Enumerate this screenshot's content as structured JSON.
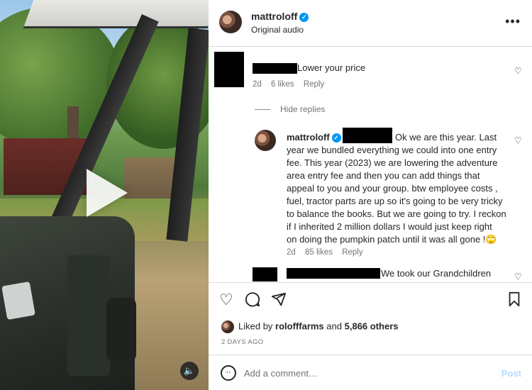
{
  "post": {
    "username": "mattroloff",
    "audio": "Original audio",
    "more_icon": "more-horizontal-icon"
  },
  "comments": {
    "first": {
      "text": "Lower your price",
      "time": "2d",
      "likes": "6 likes",
      "reply": "Reply"
    },
    "hide_replies": "Hide replies",
    "reply": {
      "username": "mattroloff",
      "lines": [
        "Ok we are this year. Last",
        "year we bundled everything we could into one entry",
        "fee. This year (2023) we are lowering the adventure",
        "area entry fee and then you can add things that",
        "appeal to you and your group. btw employee costs ,",
        "fuel, tractor parts are up so it's going to be very tricky",
        "to balance the books. But we are going to try. I reckon",
        "if I inherited 2 million dollars I would just keep right",
        "on doing the pumpkin patch until it was all gone !🙄"
      ],
      "time": "2d",
      "likes": "85 likes",
      "reply": "Reply"
    },
    "third": {
      "text": "We took our Grandchildren"
    }
  },
  "likes": {
    "prefix": "Liked by",
    "user": "rolofffarms",
    "connector": "and",
    "others": "5,866 others"
  },
  "date": "2 DAYS AGO",
  "composer": {
    "placeholder": "Add a comment…",
    "post_label": "Post"
  },
  "icons": {
    "like": "heart-icon",
    "comment": "comment-icon",
    "share": "send-icon",
    "save": "bookmark-icon",
    "emoji": "emoji-icon",
    "play": "play-icon",
    "mute": "speaker-icon"
  },
  "colors": {
    "accent": "#0095f6",
    "post_disabled": "#b3dbff",
    "muted_text": "#737373",
    "border": "#dbdbdb"
  }
}
